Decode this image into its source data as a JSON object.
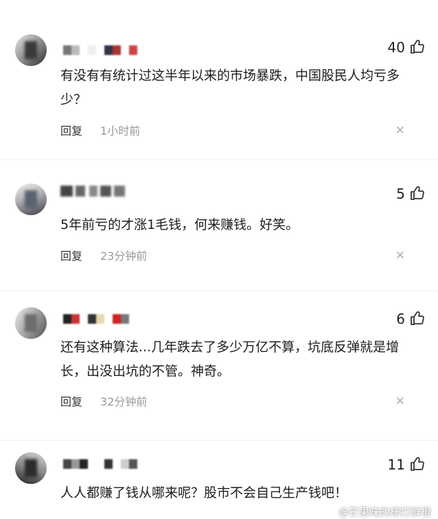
{
  "comments": [
    {
      "likes": "40",
      "text": "有没有有统计过这半年以来的市场暴跌，中国股民人均亏多少？",
      "reply_label": "回复",
      "time": "1小时前"
    },
    {
      "likes": "5",
      "text": "5年前亏的才涨1毛钱，何来赚钱。好笑。",
      "reply_label": "回复",
      "time": "23分钟前"
    },
    {
      "likes": "6",
      "text": "还有这种算法...几年跌去了多少万亿不算，坑底反弹就是增长，出没出坑的不管。神奇。",
      "reply_label": "回复",
      "time": "32分钟前"
    },
    {
      "likes": "11",
      "text": "人人都赚了钱从哪来呢？股市不会自己生产钱吧！"
    }
  ],
  "icons": {
    "like": "thumbs-up-icon",
    "close": "close-icon"
  },
  "watermark": "@芒果味的棒打鲜橙"
}
